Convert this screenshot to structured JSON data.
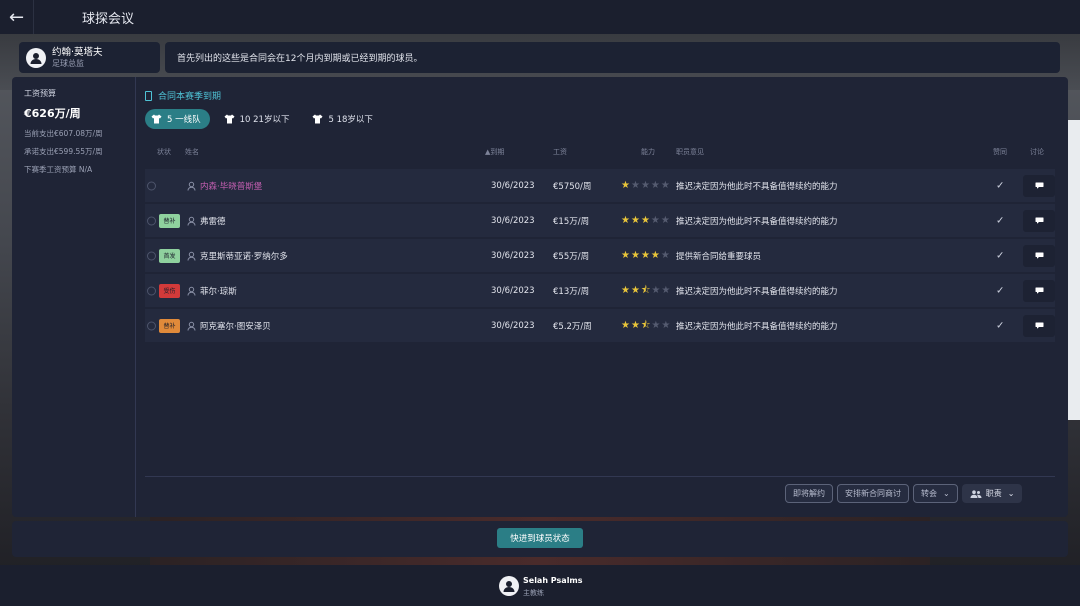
{
  "topbar": {
    "title": "球探会议"
  },
  "person": {
    "name": "约翰·莫塔夫",
    "role": "足球总监"
  },
  "message": "首先列出的这些是合同会在12个月内到期或已经到期的球员。",
  "budget": {
    "label": "工资预算",
    "amount": "€626万/周",
    "current": "当前支出€607.08万/周",
    "committed": "承诺支出€599.55万/周",
    "next": "下赛季工资预算 N/A"
  },
  "section": {
    "title": "合同本赛季到期"
  },
  "tabs": [
    {
      "label": "5 一线队"
    },
    {
      "label": "10 21岁以下"
    },
    {
      "label": "5 18岁以下"
    }
  ],
  "columns": {
    "status": "状状",
    "name": "姓名",
    "expiry": "▲到期",
    "wage": "工资",
    "ability": "能力",
    "opinion": "职员意见",
    "agree": "赞同",
    "discuss": "讨论"
  },
  "players": [
    {
      "badge": "",
      "badge_color": "",
      "name": "内森·毕晓普斯堡",
      "highlight": true,
      "expiry": "30/6/2023",
      "wage": "€5750/周",
      "stars": 1,
      "opinion": "推迟决定因为他此时不具备值得续约的能力"
    },
    {
      "badge": "替补",
      "badge_color": "#8fd19e",
      "name": "弗雷德",
      "highlight": false,
      "expiry": "30/6/2023",
      "wage": "€15万/周",
      "stars": 3,
      "opinion": "推迟决定因为他此时不具备值得续约的能力"
    },
    {
      "badge": "首发",
      "badge_color": "#8fd19e",
      "name": "克里斯蒂亚诺·罗纳尔多",
      "highlight": false,
      "expiry": "30/6/2023",
      "wage": "€55万/周",
      "stars": 4,
      "opinion": "提供新合同给重要球员"
    },
    {
      "badge": "受伤",
      "badge_color": "#d23a3a",
      "name": "菲尔·琼斯",
      "highlight": false,
      "expiry": "30/6/2023",
      "wage": "€13万/周",
      "stars": 2.5,
      "opinion": "推迟决定因为他此时不具备值得续约的能力"
    },
    {
      "badge": "替补",
      "badge_color": "#e08a3a",
      "name": "阿克塞尔·图安泽贝",
      "highlight": false,
      "expiry": "30/6/2023",
      "wage": "€5.2万/周",
      "stars": 2.5,
      "opinion": "推迟决定因为他此时不具备值得续约的能力"
    }
  ],
  "actions": {
    "release": "即将解约",
    "negotiate": "安排新合同商讨",
    "transfer": "转会",
    "duty": "职责"
  },
  "advance": "快进到球员状态",
  "manager": {
    "name": "Selah Psalms",
    "role": "主教练"
  },
  "colors": {
    "accent": "#2b7e86",
    "panel": "#1f2436",
    "star": "#e8c53a"
  }
}
